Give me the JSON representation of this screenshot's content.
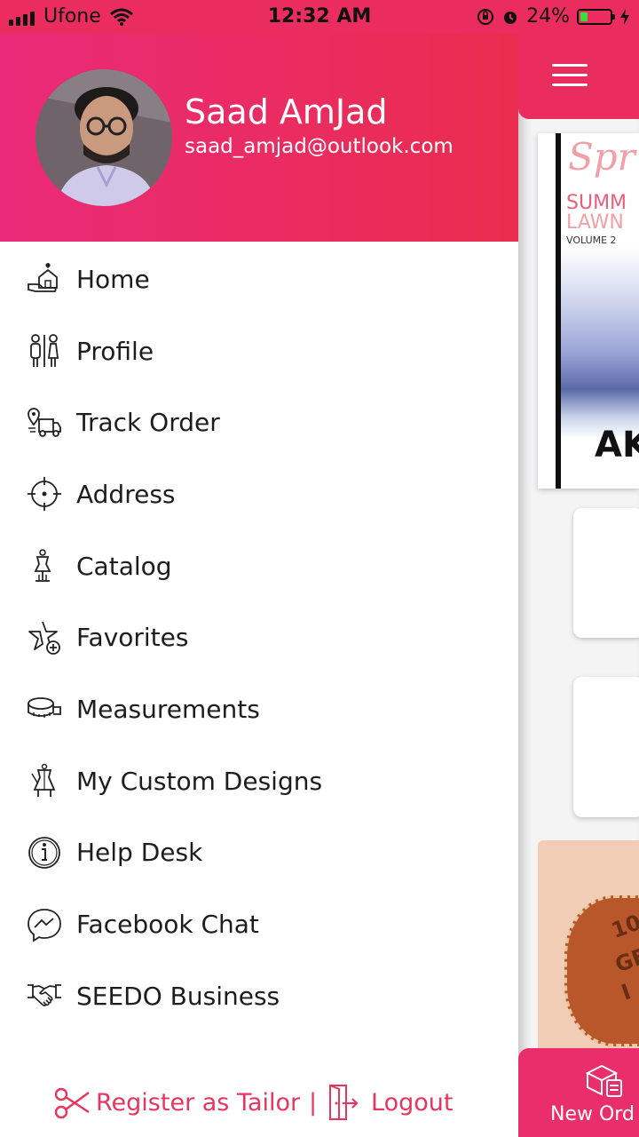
{
  "status_bar": {
    "carrier": "Ufone",
    "time": "12:32 AM",
    "battery_percent": "24%",
    "battery_level": 0.24,
    "icons": [
      "signal-icon",
      "wifi-icon",
      "orientation-lock-icon",
      "alarm-icon",
      "battery-icon",
      "charging-icon"
    ]
  },
  "profile": {
    "name": "Saad AmJad",
    "email": "saad_amjad@outlook.com"
  },
  "menu": {
    "items": [
      {
        "label": "Home",
        "icon": "home-hand-icon"
      },
      {
        "label": "Profile",
        "icon": "profile-icon"
      },
      {
        "label": "Track Order",
        "icon": "delivery-truck-icon"
      },
      {
        "label": "Address",
        "icon": "location-target-icon"
      },
      {
        "label": "Catalog",
        "icon": "mannequin-icon"
      },
      {
        "label": "Favorites",
        "icon": "star-plus-icon"
      },
      {
        "label": "Measurements",
        "icon": "measuring-tape-icon"
      },
      {
        "label": "My Custom Designs",
        "icon": "dress-design-icon"
      },
      {
        "label": "Help Desk",
        "icon": "info-icon"
      },
      {
        "label": "Facebook Chat",
        "icon": "messenger-icon"
      },
      {
        "label": "SEEDO Business",
        "icon": "handshake-icon"
      }
    ]
  },
  "footer": {
    "register_label": "Register as Tailor",
    "separator": "|",
    "logout_label": "Logout"
  },
  "main": {
    "banner": {
      "script_text": "Spr",
      "line1": "SUMM",
      "line2": "LAWN",
      "line3": "VOLUME 2",
      "brand": "AK"
    },
    "leather_text": [
      "10",
      "GE",
      "I"
    ],
    "new_order_label": "New Ord"
  },
  "colors": {
    "accent": "#ea2d5e",
    "footer_text": "#e8355e"
  }
}
